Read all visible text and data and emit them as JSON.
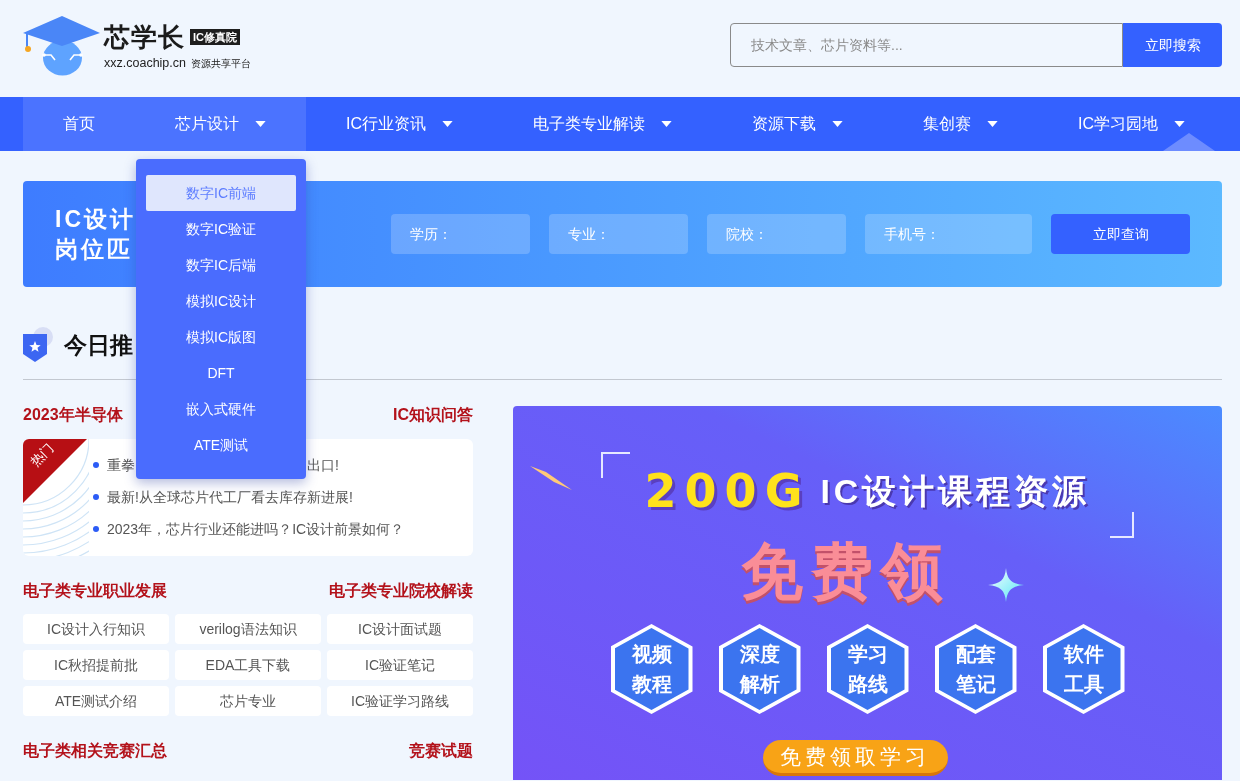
{
  "header": {
    "logo": {
      "name": "芯学长",
      "badge": "IC修真院",
      "domain": "xxz.coachip.cn",
      "slogan": "资源共享平台"
    },
    "search": {
      "placeholder": "技术文章、芯片资料等...",
      "button": "立即搜索"
    }
  },
  "nav": {
    "items": [
      {
        "label": "首页",
        "has_menu": false,
        "highlighted": true
      },
      {
        "label": "芯片设计",
        "has_menu": true,
        "highlighted": true,
        "menu": [
          {
            "label": "数字IC前端",
            "selected": true
          },
          {
            "label": "数字IC验证",
            "selected": false
          },
          {
            "label": "数字IC后端",
            "selected": false
          },
          {
            "label": "模拟IC设计",
            "selected": false
          },
          {
            "label": "模拟IC版图",
            "selected": false
          },
          {
            "label": "DFT",
            "selected": false
          },
          {
            "label": "嵌入式硬件",
            "selected": false
          },
          {
            "label": "ATE测试",
            "selected": false
          }
        ]
      },
      {
        "label": "IC行业资讯",
        "has_menu": true,
        "highlighted": false
      },
      {
        "label": "电子类专业解读",
        "has_menu": true,
        "highlighted": false
      },
      {
        "label": "资源下载",
        "has_menu": true,
        "highlighted": false
      },
      {
        "label": "集创赛",
        "has_menu": true,
        "highlighted": false
      },
      {
        "label": "IC学习园地",
        "has_menu": true,
        "highlighted": false
      }
    ]
  },
  "query_banner": {
    "title_lines": [
      "IC设计",
      "岗位匹"
    ],
    "fields": [
      {
        "placeholder": "学历："
      },
      {
        "placeholder": "专业："
      },
      {
        "placeholder": "院校："
      },
      {
        "placeholder": "手机号："
      }
    ],
    "button": "立即查询"
  },
  "section": {
    "title": "今日推"
  },
  "left_column": {
    "blocks": [
      {
        "kind": "news",
        "title": "2023年半导体",
        "link": "IC知识问答",
        "badge": "热门",
        "items": [
          {
            "parts": [
              "重拳",
              "出口!"
            ]
          },
          {
            "parts": [
              "最新!从全球芯片代工厂看去库存新进展!"
            ]
          },
          {
            "parts": [
              "2023年，芯片行业还能进吗？IC设计前景如何？"
            ]
          }
        ]
      },
      {
        "kind": "tags",
        "title": "电子类专业职业发展",
        "link": "电子类专业院校解读",
        "tags": [
          "IC设计入行知识",
          "verilog语法知识",
          "IC设计面试题",
          "IC秋招提前批",
          "EDA工具下载",
          "IC验证笔记",
          "ATE测试介绍",
          "芯片专业",
          "IC验证学习路线"
        ]
      },
      {
        "kind": "heading",
        "title": "电子类相关竞赛汇总",
        "link": "竞赛试题"
      }
    ]
  },
  "promo": {
    "highlight": "200G",
    "headline": "IC设计课程资源",
    "offer": "免费领",
    "features": [
      {
        "lines": [
          "视频",
          "教程"
        ]
      },
      {
        "lines": [
          "深度",
          "解析"
        ]
      },
      {
        "lines": [
          "学习",
          "路线"
        ]
      },
      {
        "lines": [
          "配套",
          "笔记"
        ]
      },
      {
        "lines": [
          "软件",
          "工具"
        ]
      }
    ],
    "button": "免费领取学习"
  }
}
